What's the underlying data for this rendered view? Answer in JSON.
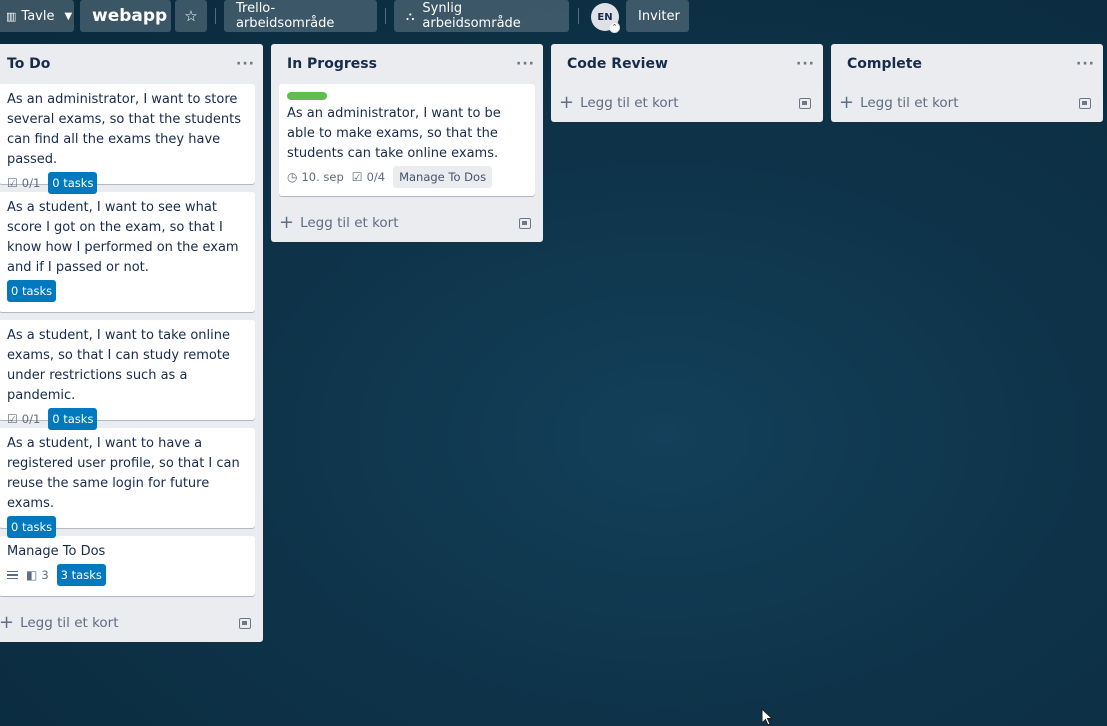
{
  "topbar": {
    "view_label": "Tavle",
    "board_name": "webapp",
    "workspace_label": "Trello-arbeidsområde",
    "visibility_label": "Synlig arbeidsområde",
    "avatar_initials": "EN",
    "invite_label": "Inviter",
    "icons": [
      "board-view-icon",
      "chevron-down-icon",
      "star-icon",
      "visibility-icon"
    ]
  },
  "lists": [
    {
      "title": "To Do",
      "add_card_label": "Legg til et kort",
      "cards": [
        {
          "title": "As an administrator, I want to store several exams, so that the students can find all the exams they have passed.",
          "checklist": "0/1",
          "tasks": "0 tasks"
        },
        {
          "title": "As a student, I want to see what score I got on the exam, so that I know how I performed on the exam and if I passed or not.",
          "tasks": "0 tasks"
        },
        {
          "title": "As a student, I want to take online exams, so that I can study remote under restrictions such as a pandemic.",
          "checklist": "0/1",
          "tasks": "0 tasks"
        },
        {
          "title": "As a student, I want to have a registered user profile, so that I can reuse the same login for future exams.",
          "tasks": "0 tasks"
        },
        {
          "title": "Manage To Dos",
          "trello_count": "3",
          "tasks": "3 tasks"
        }
      ]
    },
    {
      "title": "In Progress",
      "add_card_label": "Legg til et kort",
      "cards": [
        {
          "label_color": "#61bd4f",
          "title": "As an administrator, I want to be able to make exams, so that the students can take online exams.",
          "due": "10. sep",
          "checklist": "0/4",
          "parent": "Manage To Dos"
        }
      ]
    },
    {
      "title": "Code Review",
      "add_card_label": "Legg til et kort",
      "cards": []
    },
    {
      "title": "Complete",
      "add_card_label": "Legg til et kort",
      "cards": []
    }
  ],
  "colors": {
    "accent_blue": "#0079bf",
    "label_green": "#61bd4f",
    "list_bg": "#ebecf0",
    "board_bg": "#0e3349"
  }
}
